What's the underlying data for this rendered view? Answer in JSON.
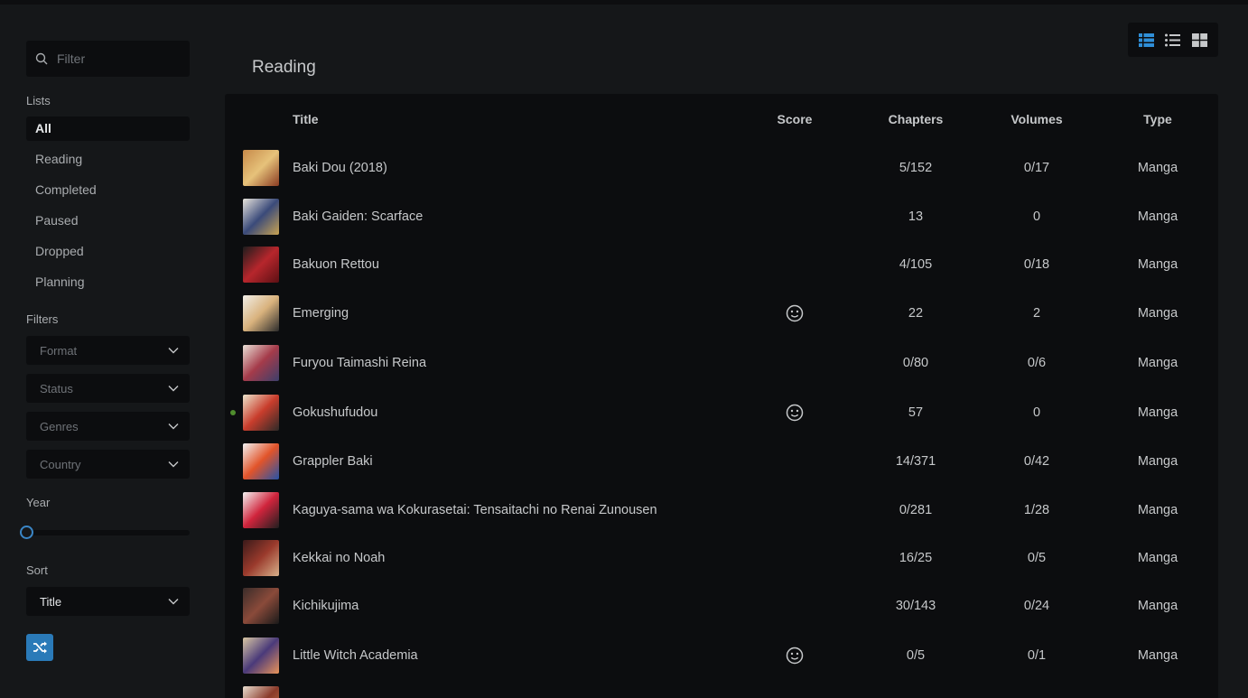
{
  "sidebar": {
    "filter_placeholder": "Filter",
    "lists_label": "Lists",
    "lists": [
      "All",
      "Reading",
      "Completed",
      "Paused",
      "Dropped",
      "Planning"
    ],
    "active_list": "All",
    "filters_label": "Filters",
    "filters": [
      "Format",
      "Status",
      "Genres",
      "Country"
    ],
    "year_label": "Year",
    "year_slider_value": 0,
    "sort_label": "Sort",
    "sort_value": "Title"
  },
  "view_toggles": [
    "detailed-list-icon",
    "simple-list-icon",
    "grid-icon"
  ],
  "active_view": "detailed-list-icon",
  "section_title": "Reading",
  "table": {
    "headers": {
      "title": "Title",
      "score": "Score",
      "chapters": "Chapters",
      "volumes": "Volumes",
      "type": "Type"
    },
    "rows": [
      {
        "title": "Baki Dou (2018)",
        "score_icon": false,
        "chapters": "5/152",
        "volumes": "0/17",
        "type": "Manga",
        "dot": false,
        "cover": [
          "#c78a4a",
          "#e6c27a",
          "#8a3b22"
        ]
      },
      {
        "title": "Baki Gaiden: Scarface",
        "score_icon": false,
        "chapters": "13",
        "volumes": "0",
        "type": "Manga",
        "dot": false,
        "cover": [
          "#e8e4dc",
          "#3a4a7a",
          "#c9a352"
        ]
      },
      {
        "title": "Bakuon Rettou",
        "score_icon": false,
        "chapters": "4/105",
        "volumes": "0/18",
        "type": "Manga",
        "dot": false,
        "cover": [
          "#1d1d1d",
          "#b7262c",
          "#5c1014"
        ]
      },
      {
        "title": "Emerging",
        "score_icon": true,
        "chapters": "22",
        "volumes": "2",
        "type": "Manga",
        "dot": false,
        "cover": [
          "#f1efe8",
          "#d9b27d",
          "#2b2b2b"
        ]
      },
      {
        "title": "Furyou Taimashi Reina",
        "score_icon": false,
        "chapters": "0/80",
        "volumes": "0/6",
        "type": "Manga",
        "dot": false,
        "cover": [
          "#e9e0d6",
          "#a53b4a",
          "#3b3f6b"
        ]
      },
      {
        "title": "Gokushufudou",
        "score_icon": true,
        "chapters": "57",
        "volumes": "0",
        "type": "Manga",
        "dot": true,
        "cover": [
          "#ece4cc",
          "#c93d2c",
          "#2c2a28"
        ]
      },
      {
        "title": "Grappler Baki",
        "score_icon": false,
        "chapters": "14/371",
        "volumes": "0/42",
        "type": "Manga",
        "dot": false,
        "cover": [
          "#f2f2f2",
          "#e2542a",
          "#2453a8"
        ]
      },
      {
        "title": "Kaguya-sama wa Kokurasetai: Tensaitachi no Renai Zunousen",
        "score_icon": false,
        "chapters": "0/281",
        "volumes": "1/28",
        "type": "Manga",
        "dot": false,
        "cover": [
          "#f4f2f2",
          "#d0243c",
          "#1f1f1f"
        ]
      },
      {
        "title": "Kekkai no Noah",
        "score_icon": false,
        "chapters": "16/25",
        "volumes": "0/5",
        "type": "Manga",
        "dot": false,
        "cover": [
          "#3a1a1a",
          "#9a3a2c",
          "#d8b08a"
        ]
      },
      {
        "title": "Kichikujima",
        "score_icon": false,
        "chapters": "30/143",
        "volumes": "0/24",
        "type": "Manga",
        "dot": false,
        "cover": [
          "#3a2c2a",
          "#8a4a3a",
          "#1a1a1a"
        ]
      },
      {
        "title": "Little Witch Academia",
        "score_icon": true,
        "chapters": "0/5",
        "volumes": "0/1",
        "type": "Manga",
        "dot": false,
        "cover": [
          "#d9c7a3",
          "#4a3a7a",
          "#e8935a"
        ]
      },
      {
        "title": "",
        "score_icon": false,
        "chapters": "",
        "volumes": "",
        "type": "",
        "dot": false,
        "cover": [
          "#e9ded0",
          "#8a3a2a",
          "#c77a4a"
        ]
      }
    ]
  },
  "colors": {
    "accent": "#2a7ab8",
    "toggle_active": "#2f8fd8",
    "dot": "#4f8d2d"
  }
}
